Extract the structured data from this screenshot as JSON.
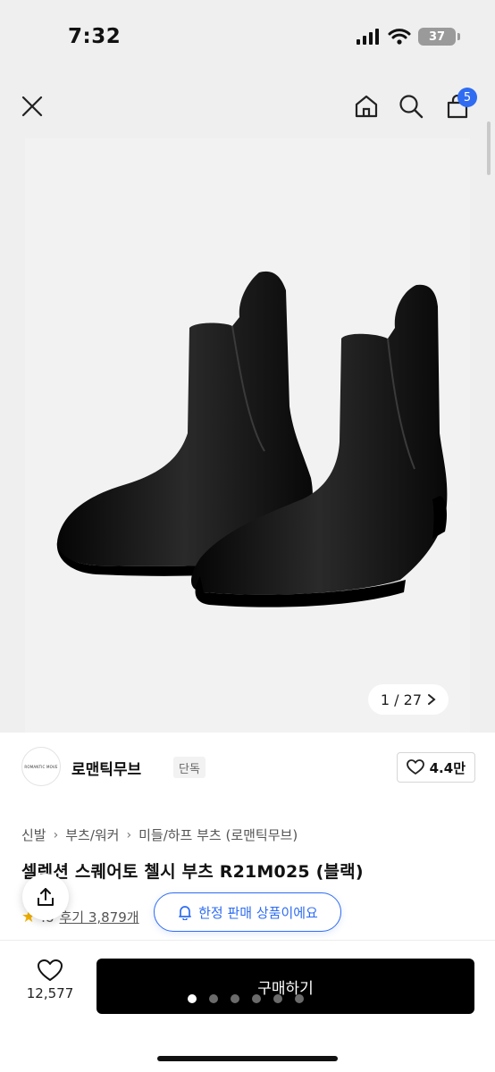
{
  "status_bar": {
    "time": "7:32",
    "battery": "37",
    "icons": [
      "cellular-signal-icon",
      "wifi-icon",
      "battery-icon"
    ]
  },
  "nav": {
    "cart_count": "5",
    "icons": [
      "close-icon",
      "home-icon",
      "search-icon",
      "cart-icon"
    ]
  },
  "gallery": {
    "current": "1",
    "separator": "/",
    "total": "27",
    "counter_text": "1 / 27",
    "page_dots": 6,
    "active_dot": 1
  },
  "brand": {
    "logo_text": "ROMANTIC MOVE",
    "name": "로맨틱무브",
    "tag": "단독",
    "likes": "4.4만"
  },
  "breadcrumb": [
    "신발",
    "부츠/워커",
    "미들/하프 부츠 (로맨틱무브)"
  ],
  "product": {
    "title": "셀렉션 스퀘어토 첼시 부츠 R21M025 (블랙)",
    "rating": "4.8",
    "rating_visible": ".8",
    "reviews": "후기 3,879개",
    "reviews_visible": "후기 3,879개"
  },
  "notice": {
    "limited_text": "한정 판매 상품이에요"
  },
  "bottom": {
    "wish_count": "12,577",
    "buy_label": "구매하기"
  },
  "colors": {
    "accent": "#2f6cf2",
    "buy_button": "#000000",
    "star": "#f5b400"
  }
}
